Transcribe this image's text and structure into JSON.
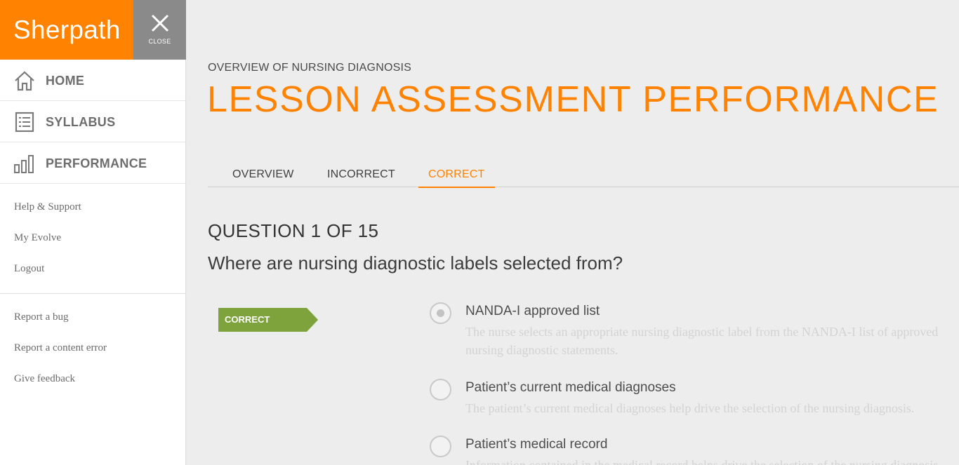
{
  "app": {
    "brand": "Sherpath",
    "close_label": "CLOSE"
  },
  "sidebar": {
    "nav": [
      {
        "label": "HOME",
        "icon": "home-icon"
      },
      {
        "label": "SYLLABUS",
        "icon": "syllabus-icon"
      },
      {
        "label": "PERFORMANCE",
        "icon": "performance-chart-icon"
      }
    ],
    "links": [
      "Help & Support",
      "My Evolve",
      "Logout"
    ],
    "feedback_links": [
      "Report a bug",
      "Report a content error",
      "Give feedback"
    ]
  },
  "main": {
    "breadcrumb": "OVERVIEW OF NURSING DIAGNOSIS",
    "title": "LESSON ASSESSMENT PERFORMANCE",
    "tabs": [
      {
        "label": "OVERVIEW",
        "active": false
      },
      {
        "label": "INCORRECT",
        "active": false
      },
      {
        "label": "CORRECT",
        "active": true
      }
    ],
    "question": {
      "number_label": "QUESTION 1 OF 15",
      "text": "Where are nursing diagnostic labels selected from?",
      "result": "CORRECT",
      "answers": [
        {
          "label": "NANDA-I approved list",
          "rationale": "The nurse selects an appropriate nursing diagnostic label from the NANDA-I list of approved nursing diagnostic statements.",
          "selected": true
        },
        {
          "label": "Patient’s current medical diagnoses",
          "rationale": "The patient’s current medical diagnoses help drive the selection of the nursing diagnosis.",
          "selected": false
        },
        {
          "label": "Patient’s medical record",
          "rationale": "Information contained in the medical record helps drive the selection of the nursing diagnosis.",
          "selected": false
        }
      ]
    }
  },
  "colors": {
    "brand_orange": "#ff8200",
    "correct_green": "#7ea23c",
    "close_gray": "#8a8a8a"
  }
}
